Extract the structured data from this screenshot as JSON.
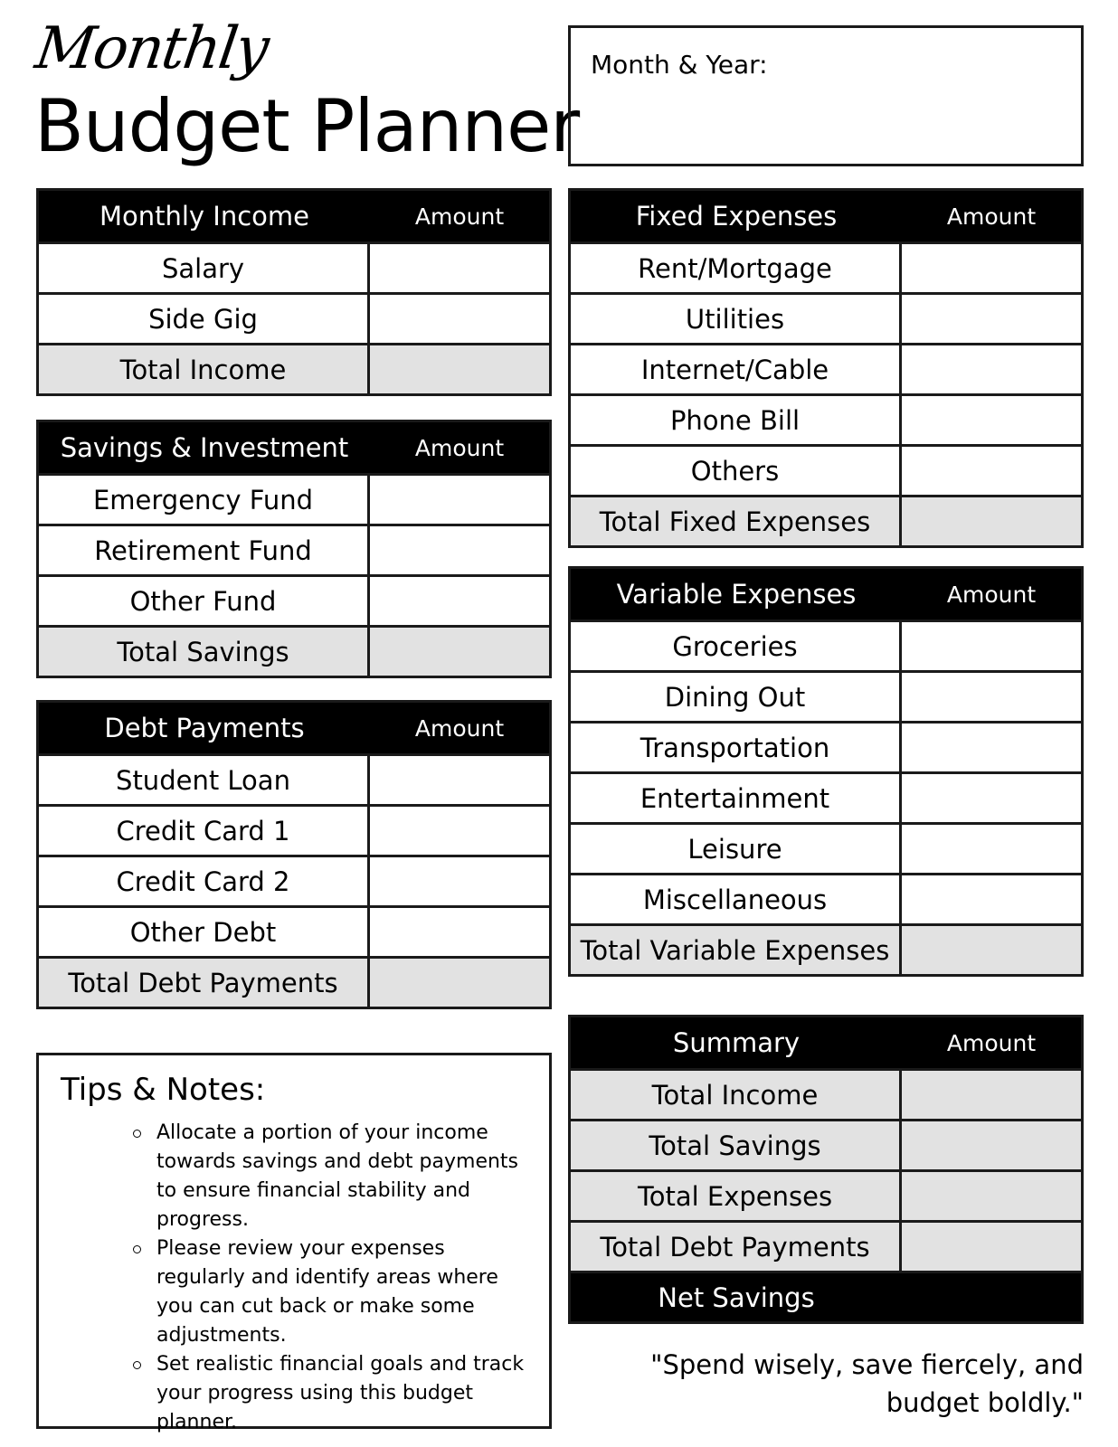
{
  "header": {
    "script_title": "Monthly",
    "title": "Budget Planner",
    "month_year_label": "Month & Year:"
  },
  "tables": {
    "income": {
      "title": "Monthly Income",
      "amount_label": "Amount",
      "rows": [
        "Salary",
        "Side Gig"
      ],
      "total": "Total Income"
    },
    "savings": {
      "title": "Savings & Investment",
      "amount_label": "Amount",
      "rows": [
        "Emergency Fund",
        "Retirement Fund",
        "Other Fund"
      ],
      "total": "Total Savings"
    },
    "debt": {
      "title": "Debt Payments",
      "amount_label": "Amount",
      "rows": [
        "Student Loan",
        "Credit Card 1",
        "Credit Card 2",
        "Other Debt"
      ],
      "total": "Total Debt Payments"
    },
    "fixed": {
      "title": "Fixed Expenses",
      "amount_label": "Amount",
      "rows": [
        "Rent/Mortgage",
        "Utilities",
        "Internet/Cable",
        "Phone Bill",
        "Others"
      ],
      "total": "Total Fixed Expenses"
    },
    "variable": {
      "title": "Variable Expenses",
      "amount_label": "Amount",
      "rows": [
        "Groceries",
        "Dining Out",
        "Transportation",
        "Entertainment",
        "Leisure",
        "Miscellaneous"
      ],
      "total": "Total Variable Expenses"
    },
    "summary": {
      "title": "Summary",
      "amount_label": "Amount",
      "rows": [
        "Total Income",
        "Total Savings",
        "Total Expenses",
        "Total Debt Payments"
      ],
      "net": "Net Savings"
    }
  },
  "tips": {
    "title": "Tips & Notes:",
    "items": [
      "Allocate a portion of your income towards savings and debt payments to ensure financial stability and progress.",
      "Please review your expenses regularly and identify areas where you can cut back or make some adjustments.",
      "Set realistic financial goals and track your progress using this budget planner."
    ]
  },
  "quote": "\"Spend wisely, save fiercely, and budget boldly.\""
}
